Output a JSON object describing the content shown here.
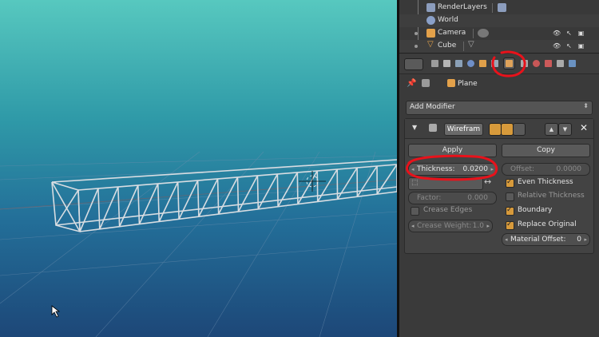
{
  "outliner": {
    "rows": [
      {
        "label": "RenderLayers"
      },
      {
        "label": "World"
      },
      {
        "label": "Camera"
      },
      {
        "label": "Cube"
      }
    ]
  },
  "context": {
    "object_label": "Plane"
  },
  "add_modifier": {
    "label": "Add Modifier"
  },
  "modifier": {
    "name": "Wirefram",
    "apply_label": "Apply",
    "copy_label": "Copy",
    "thickness": {
      "label": "Thickness:",
      "value": "0.0200"
    },
    "offset": {
      "label": "Offset:",
      "value": "0.0000"
    },
    "factor": {
      "label": "Factor:",
      "value": "0.000"
    },
    "crease_weight": {
      "label": "Crease Weight:",
      "value": "1.0"
    },
    "material_offset": {
      "label": "Material Offset:",
      "value": "0"
    },
    "checks": {
      "even_thickness": {
        "label": "Even Thickness",
        "checked": true
      },
      "relative_thickness": {
        "label": "Relative Thickness",
        "checked": false
      },
      "crease_edges": {
        "label": "Crease Edges",
        "checked": false
      },
      "boundary": {
        "label": "Boundary",
        "checked": true
      },
      "replace_original": {
        "label": "Replace Original",
        "checked": true
      }
    }
  },
  "colors": {
    "viewport_top": "#57c8bf",
    "viewport_bottom": "#1d4778",
    "accent_orange": "#d79a3b",
    "annotation_red": "#e8121b",
    "panel_bg": "#3a3a3a"
  }
}
